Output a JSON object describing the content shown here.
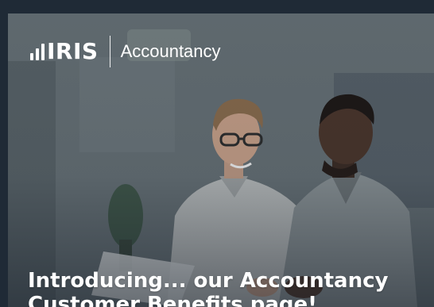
{
  "brand": {
    "name": "IRIS",
    "division": "Accountancy",
    "logo_icon": "signal-bars-icon"
  },
  "hero": {
    "headline": "Introducing... our Accountancy Customer Benefits page!",
    "image_description_icon": "people-photo-icon"
  },
  "colors": {
    "page_background": "#1f2a36",
    "text": "#ffffff"
  }
}
